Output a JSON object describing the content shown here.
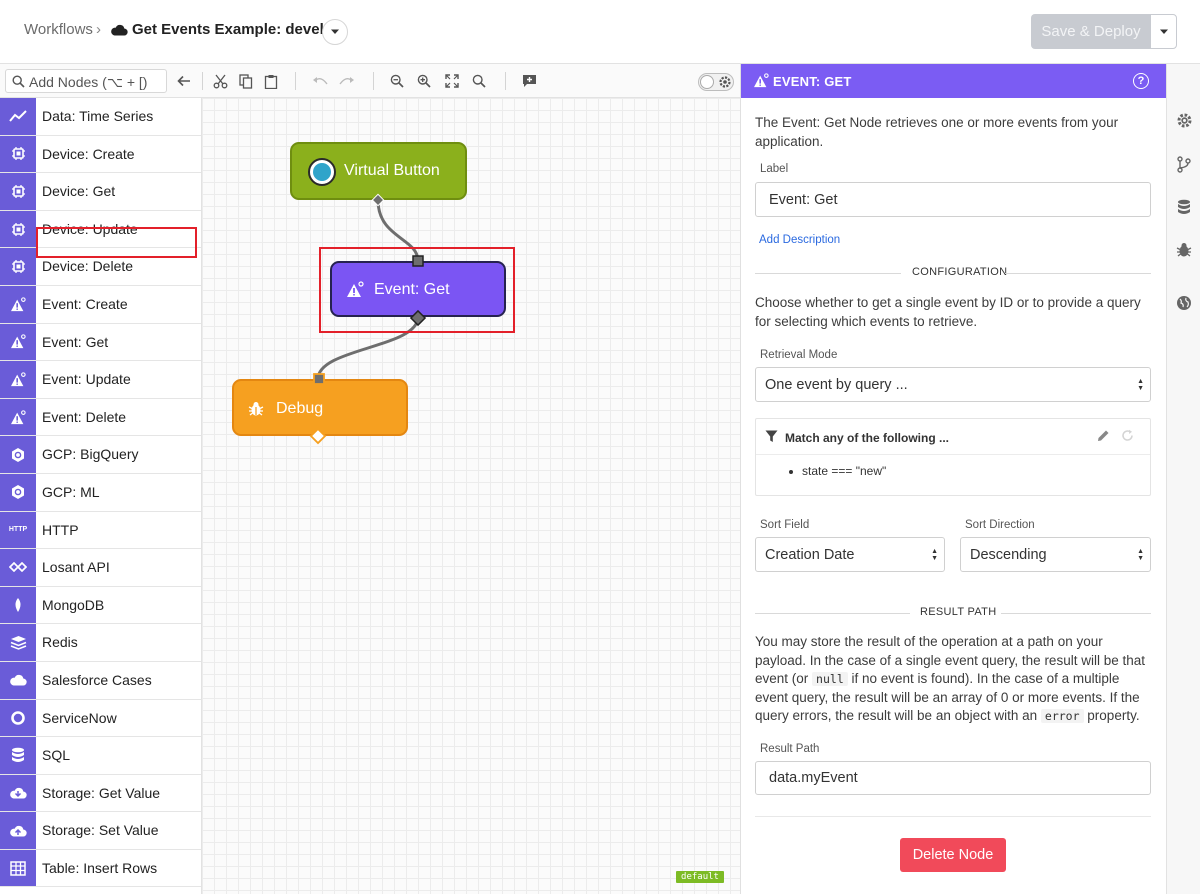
{
  "header": {
    "breadcrumb_root": "Workflows",
    "separator": "›",
    "workflow_title": "Get Events Example: develop",
    "save_label": "Save & Deploy"
  },
  "toolbar": {
    "search_placeholder": "Add Nodes (⌥ + [)",
    "icons": [
      "back-arrow-icon",
      "cut-icon",
      "copy-icon",
      "paste-icon",
      "undo-icon",
      "redo-icon",
      "zoom-out-icon",
      "zoom-in-icon",
      "fit-icon",
      "search-zoom-icon",
      "add-comment-icon"
    ]
  },
  "palette": {
    "items": [
      {
        "label": "Data: Time Series",
        "icon": "trend-icon"
      },
      {
        "label": "Device: Create",
        "icon": "device-icon"
      },
      {
        "label": "Device: Get",
        "icon": "device-icon"
      },
      {
        "label": "Device: Update",
        "icon": "device-icon"
      },
      {
        "label": "Device: Delete",
        "icon": "device-icon"
      },
      {
        "label": "Event: Create",
        "icon": "event-icon"
      },
      {
        "label": "Event: Get",
        "icon": "event-icon"
      },
      {
        "label": "Event: Update",
        "icon": "event-icon"
      },
      {
        "label": "Event: Delete",
        "icon": "event-icon"
      },
      {
        "label": "GCP: BigQuery",
        "icon": "gcp-icon"
      },
      {
        "label": "GCP: ML",
        "icon": "gcp-icon"
      },
      {
        "label": "HTTP",
        "icon": "http-icon"
      },
      {
        "label": "Losant API",
        "icon": "losant-icon"
      },
      {
        "label": "MongoDB",
        "icon": "leaf-icon"
      },
      {
        "label": "Redis",
        "icon": "stack-icon"
      },
      {
        "label": "Salesforce Cases",
        "icon": "cloud-icon"
      },
      {
        "label": "ServiceNow",
        "icon": "ring-icon"
      },
      {
        "label": "SQL",
        "icon": "database-icon"
      },
      {
        "label": "Storage: Get Value",
        "icon": "cloud-download-icon"
      },
      {
        "label": "Storage: Set Value",
        "icon": "cloud-upload-icon"
      },
      {
        "label": "Table: Insert Rows",
        "icon": "table-icon"
      }
    ],
    "http_badge": "HTTP"
  },
  "canvas": {
    "nodes": {
      "virtual_button": "Virtual Button",
      "event_get": "Event: Get",
      "debug": "Debug"
    },
    "badge": "default"
  },
  "panel": {
    "title": "EVENT: GET",
    "help": "?",
    "description": "The Event: Get Node retrieves one or more events from your application.",
    "label_field_label": "Label",
    "label_value": "Event: Get",
    "add_description": "Add Description",
    "configuration_heading": "CONFIGURATION",
    "configuration_text": "Choose whether to get a single event by ID or to provide a query for selecting which events to retrieve.",
    "retrieval_mode_label": "Retrieval Mode",
    "retrieval_mode_value": "One event by query ...",
    "query_title": "Match any of the following ...",
    "query_items": [
      "state === \"new\""
    ],
    "sort_field_label": "Sort Field",
    "sort_field_value": "Creation Date",
    "sort_direction_label": "Sort Direction",
    "sort_direction_value": "Descending",
    "result_path_heading": "RESULT PATH",
    "result_text_1": "You may store the result of the operation at a path on your payload. In the case of a single event query, the result will be that event (or",
    "result_code_null": "null",
    "result_text_2": "if no event is found). In the case of a multiple event query, the result will be an array of 0 or more events. If the query errors, the result will be an object with an",
    "result_code_error": "error",
    "result_text_3": "property.",
    "result_path_label": "Result Path",
    "result_path_value": "data.myEvent",
    "delete_label": "Delete Node"
  },
  "colors": {
    "accent": "#7b5cf3",
    "palette_icon_bg": "#6a5cd8",
    "virtual_button": "#8bb01c",
    "event_node": "#7b55f3",
    "debug_node": "#f6a020",
    "delete": "#f14a5a",
    "highlight": "#e3202a"
  }
}
